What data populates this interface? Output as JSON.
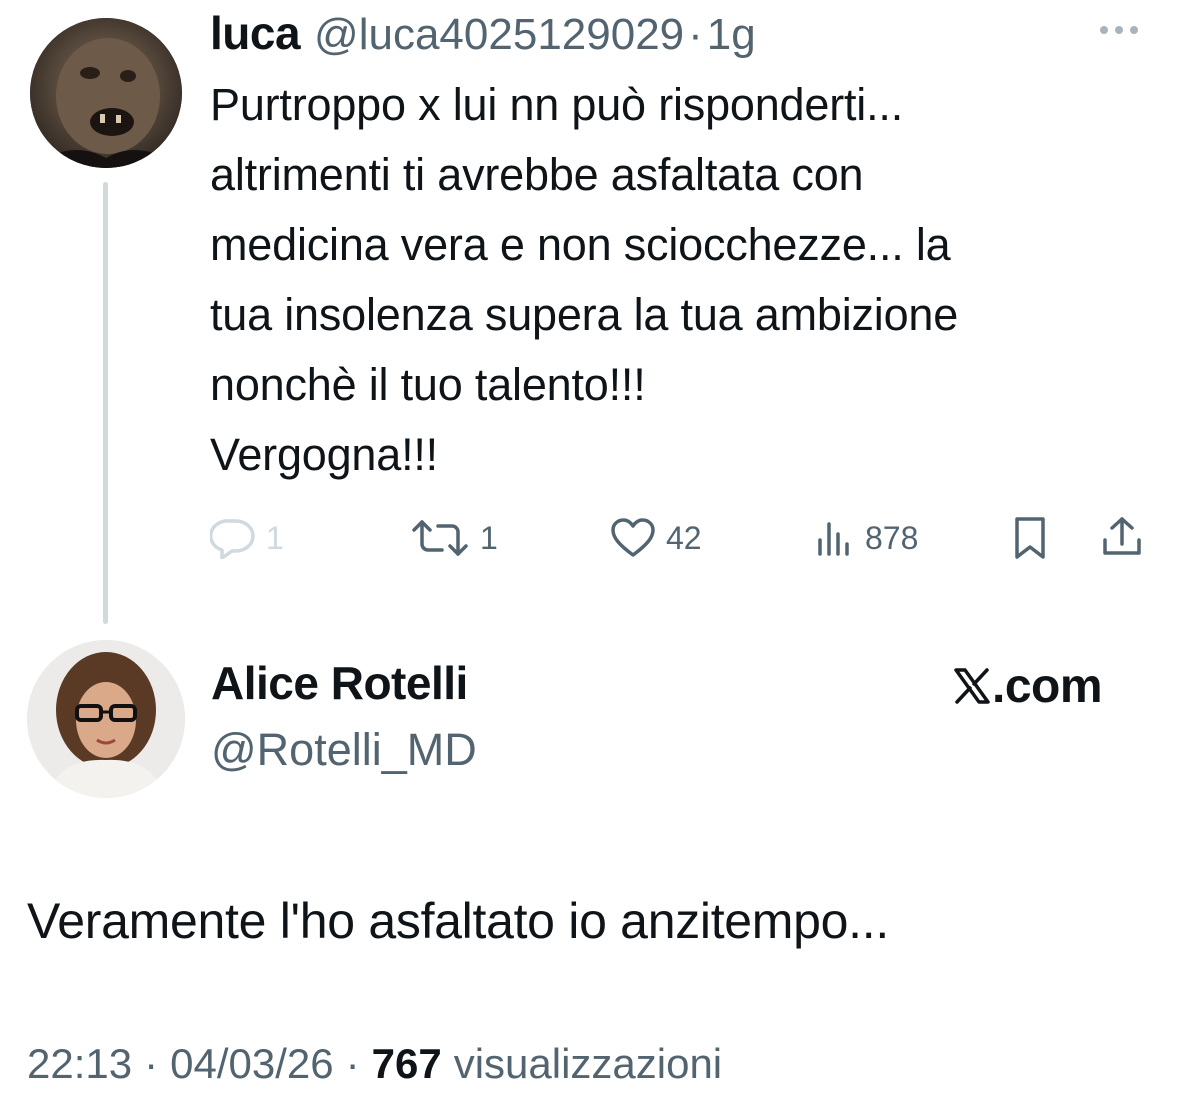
{
  "parent_tweet": {
    "author_name": "luca",
    "author_handle": "@luca4025129029",
    "separator": "·",
    "time": "1g",
    "more_icon": "more-horizontal-icon",
    "text_lines": [
      "Purtroppo x lui nn può risponderti...",
      "altrimenti ti avrebbe asfaltata con",
      "medicina vera e non sciocchezze... la",
      "tua insolenza supera la tua ambizione",
      "nonchè il tuo talento!!!",
      "Vergogna!!!"
    ],
    "actions": {
      "replies": "1",
      "reposts": "1",
      "likes": "42",
      "views": "878"
    }
  },
  "main_tweet": {
    "author_name": "Alice Rotelli",
    "author_handle": "@Rotelli_MD",
    "brand_label": ".com",
    "text": "Veramente l'ho asfaltato io anzitempo...",
    "time": "22:13",
    "separator": "·",
    "date": "04/03/26",
    "views_count": "767",
    "views_label": "visualizzazioni"
  },
  "colors": {
    "text": "#0f1419",
    "secondary": "#536471",
    "thread_line": "#cfd9de"
  }
}
